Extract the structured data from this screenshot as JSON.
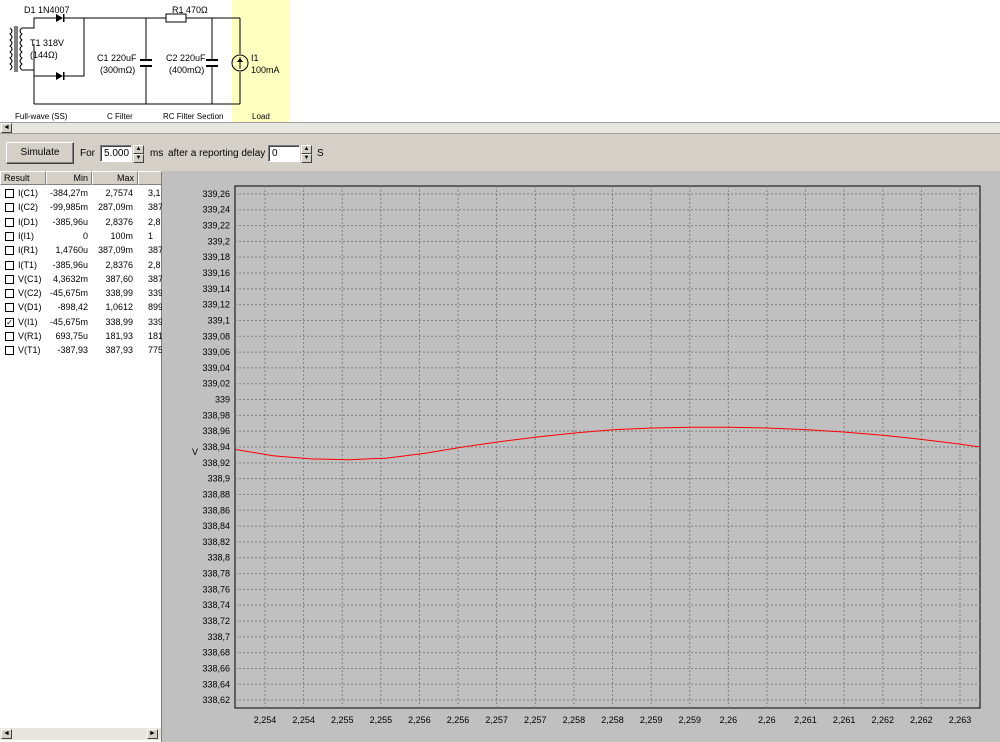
{
  "schematic": {
    "diode": "D1 1N4007",
    "transformer_name": "T1 318V",
    "transformer_res": "(144Ω)",
    "resistor": "R1 470Ω",
    "c1_name": "C1 220uF",
    "c1_esr": "(300mΩ)",
    "c2_name": "C2 220uF",
    "c2_esr": "(400mΩ)",
    "source_name": "I1",
    "source_value": "100mA",
    "section_rectifier": "Full-wave (SS)",
    "section_cfilter": "C Filter",
    "section_rcfilter": "RC Filter Section",
    "section_load": "Load"
  },
  "toolbar": {
    "simulate_label": "Simulate",
    "for_label": "For",
    "duration_value": "5.000",
    "duration_unit": "ms",
    "delay_label": "after a reporting delay of",
    "delay_value": "0",
    "delay_unit": "S"
  },
  "results": {
    "headers": [
      "Result",
      "Min",
      "Max"
    ],
    "rows": [
      {
        "name": "I(C1)",
        "min": "-384,27m",
        "max": "2,7574",
        "extra": "3,1",
        "checked": false
      },
      {
        "name": "I(C2)",
        "min": "-99,985m",
        "max": "287,09m",
        "extra": "387,",
        "checked": false
      },
      {
        "name": "I(D1)",
        "min": "-385,96u",
        "max": "2,8376",
        "extra": "2,8",
        "checked": false
      },
      {
        "name": "I(I1)",
        "min": "0",
        "max": "100m",
        "extra": "1",
        "checked": false
      },
      {
        "name": "I(R1)",
        "min": "1,4760u",
        "max": "387,09m",
        "extra": "387,",
        "checked": false
      },
      {
        "name": "I(T1)",
        "min": "-385,96u",
        "max": "2,8376",
        "extra": "2,8",
        "checked": false
      },
      {
        "name": "V(C1)",
        "min": "4,3632m",
        "max": "387,60",
        "extra": "387",
        "checked": false
      },
      {
        "name": "V(C2)",
        "min": "-45,675m",
        "max": "338,99",
        "extra": "339",
        "checked": false
      },
      {
        "name": "V(D1)",
        "min": "-898,42",
        "max": "1,0612",
        "extra": "899",
        "checked": false
      },
      {
        "name": "V(I1)",
        "min": "-45,675m",
        "max": "338,99",
        "extra": "339",
        "checked": true
      },
      {
        "name": "V(R1)",
        "min": "693,75u",
        "max": "181,93",
        "extra": "181",
        "checked": false
      },
      {
        "name": "V(T1)",
        "min": "-387,93",
        "max": "387,93",
        "extra": "775",
        "checked": false
      }
    ]
  },
  "chart_data": {
    "type": "line",
    "ylabel": "V",
    "ylim": [
      338.61,
      339.27
    ],
    "yticks": [
      "339,26",
      "339,24",
      "339,22",
      "339,2",
      "339,18",
      "339,16",
      "339,14",
      "339,12",
      "339,1",
      "339,08",
      "339,06",
      "339,04",
      "339,02",
      "339",
      "338,98",
      "338,96",
      "338,94",
      "338,92",
      "338,9",
      "338,88",
      "338,86",
      "338,84",
      "338,82",
      "338,8",
      "338,78",
      "338,76",
      "338,74",
      "338,72",
      "338,7",
      "338,68",
      "338,66",
      "338,64",
      "338,62"
    ],
    "xticks": [
      "2,254",
      "2,254",
      "2,255",
      "2,255",
      "2,256",
      "2,256",
      "2,257",
      "2,257",
      "2,258",
      "2,258",
      "2,259",
      "2,259",
      "2,26",
      "2,26",
      "2,261",
      "2,261",
      "2,262",
      "2,262",
      "2,263"
    ],
    "grid": true,
    "series": [
      {
        "color": "#ff0000",
        "x": [
          2.2535,
          2.254,
          2.2545,
          2.255,
          2.2555,
          2.256,
          2.2565,
          2.257,
          2.2575,
          2.258,
          2.2585,
          2.259,
          2.2595,
          2.26,
          2.2605,
          2.261,
          2.2615,
          2.262,
          2.2625,
          2.263,
          2.2633
        ],
        "values": [
          338.937,
          338.929,
          338.925,
          338.924,
          338.926,
          338.932,
          338.94,
          338.947,
          338.953,
          338.958,
          338.962,
          338.964,
          338.965,
          338.965,
          338.964,
          338.962,
          338.959,
          338.955,
          338.95,
          338.944,
          338.94
        ]
      }
    ]
  }
}
